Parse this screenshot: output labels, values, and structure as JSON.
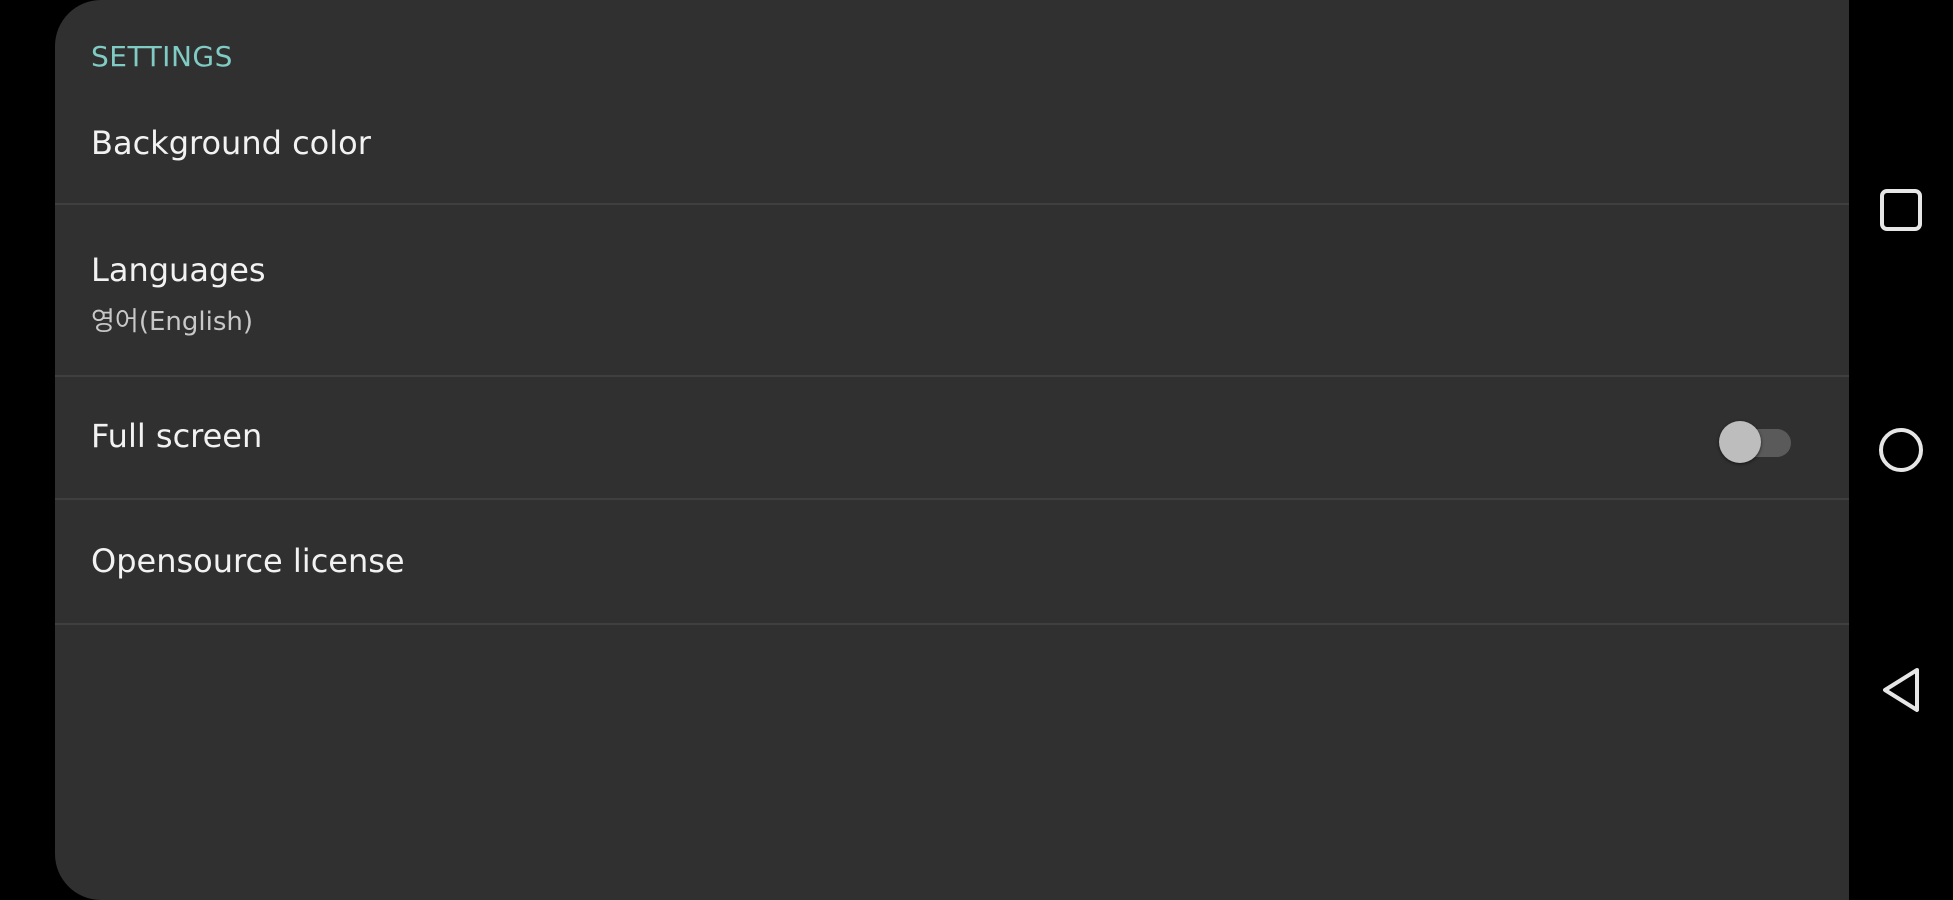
{
  "settings": {
    "header": "SETTINGS",
    "background_color": {
      "title": "Background color"
    },
    "languages": {
      "title": "Languages",
      "value": "영어(English)"
    },
    "full_screen": {
      "title": "Full screen",
      "enabled": false
    },
    "opensource_license": {
      "title": "Opensource license"
    }
  },
  "navbar": {
    "recent": {
      "icon": "recent-apps-icon"
    },
    "home": {
      "icon": "home-icon"
    },
    "back": {
      "icon": "back-icon"
    }
  },
  "colors": {
    "panel_background": "#303030",
    "accent": "#80cbc4",
    "text_primary": "#f2f2f2",
    "divider": "#3f3f3f",
    "screen_background": "#000000"
  }
}
